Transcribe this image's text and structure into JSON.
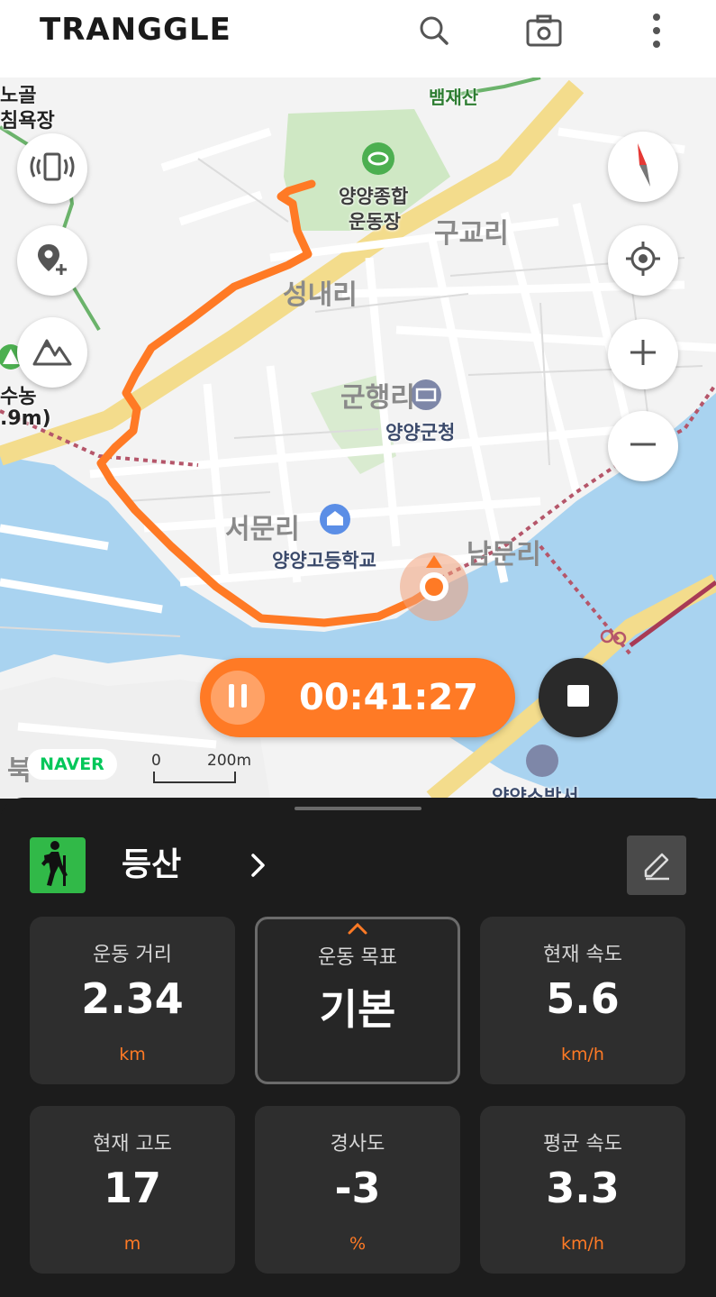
{
  "app": {
    "logo": "TRANGGLE"
  },
  "topbar": {
    "icons": [
      "search-icon",
      "camera-icon",
      "more-vertical-icon"
    ]
  },
  "map": {
    "labels": {
      "nogol": "노골",
      "yokjang": "침욕장",
      "baemjaesan": "뱀재산",
      "stadium1": "양양종합",
      "stadium2": "운동장",
      "gugyo": "구교리",
      "seongnae": "성내리",
      "gunhaeng": "군행리",
      "county_office": "양양군청",
      "seomun": "서문리",
      "highschool": "양양고등학교",
      "nammun": "남문리",
      "susong": "수농",
      "elev": ".9m)",
      "buk": "북",
      "firestation": "양양소방서"
    },
    "naver_badge": "NAVER",
    "scale": {
      "zero": "0",
      "distance": "200m"
    },
    "buttons": [
      "vibration-icon",
      "add-location-icon",
      "mountain-icon",
      "compass-icon",
      "my-location-icon",
      "zoom-in-icon",
      "zoom-out-icon"
    ],
    "route_color": "#ff7a25"
  },
  "recording": {
    "elapsed": "00:41:27",
    "pause_icon": "pause-icon",
    "stop_icon": "stop-icon"
  },
  "activity": {
    "name": "등산",
    "icon": "hiking-icon",
    "icon_bg": "#31b948"
  },
  "stats": [
    {
      "label": "운동 거리",
      "value": "2.34",
      "unit": "km"
    },
    {
      "label": "운동 목표",
      "value": "기본",
      "unit": ""
    },
    {
      "label": "현재 속도",
      "value": "5.6",
      "unit": "km/h"
    },
    {
      "label": "현재 고도",
      "value": "17",
      "unit": "m"
    },
    {
      "label": "경사도",
      "value": "-3",
      "unit": "%"
    },
    {
      "label": "평균 속도",
      "value": "3.3",
      "unit": "km/h"
    }
  ]
}
